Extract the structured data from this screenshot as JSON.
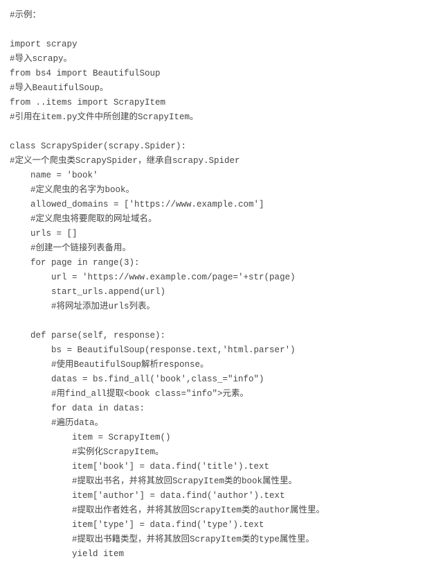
{
  "code": {
    "l01": "#示例：",
    "l02": "",
    "l03": "import scrapy",
    "l04": "#导入scrapy。",
    "l05": "from bs4 import BeautifulSoup",
    "l06": "#导入BeautifulSoup。",
    "l07": "from ..items import ScrapyItem",
    "l08": "#引用在item.py文件中所创建的ScrapyItem。",
    "l09": "",
    "l10": "class ScrapySpider(scrapy.Spider):",
    "l11": "#定义一个爬虫类ScrapySpider，继承自scrapy.Spider",
    "l12": "    name = 'book'",
    "l13": "    #定义爬虫的名字为book。",
    "l14": "    allowed_domains = ['https://www.example.com']",
    "l15": "    #定义爬虫将要爬取的网址域名。",
    "l16": "    urls = []",
    "l17": "    #创建一个链接列表备用。",
    "l18": "    for page in range(3):",
    "l19": "        url = 'https://www.example.com/page='+str(page)",
    "l20": "        start_urls.append(url)",
    "l21": "        #将网址添加进urls列表。",
    "l22": "",
    "l23": "    def parse(self, response):",
    "l24": "        bs = BeautifulSoup(response.text,'html.parser')",
    "l25": "        #使用BeautifulSoup解析response。",
    "l26": "        datas = bs.find_all('book',class_=\"info\")",
    "l27": "        #用find_all提取<book class=\"info\">元素。",
    "l28": "        for data in datas:",
    "l29": "        #遍历data。",
    "l30": "            item = ScrapyItem()",
    "l31": "            #实例化ScrapyItem。",
    "l32": "            item['book'] = data.find('title').text",
    "l33": "            #提取出书名，并将其放回ScrapyItem类的book属性里。",
    "l34": "            item['author'] = data.find('author').text",
    "l35": "            #提取出作者姓名，并将其放回ScrapyItem类的author属性里。",
    "l36": "            item['type'] = data.find('type').text",
    "l37": "            #提取出书籍类型，并将其放回ScrapyItem类的type属性里。",
    "l38": "            yield item"
  }
}
